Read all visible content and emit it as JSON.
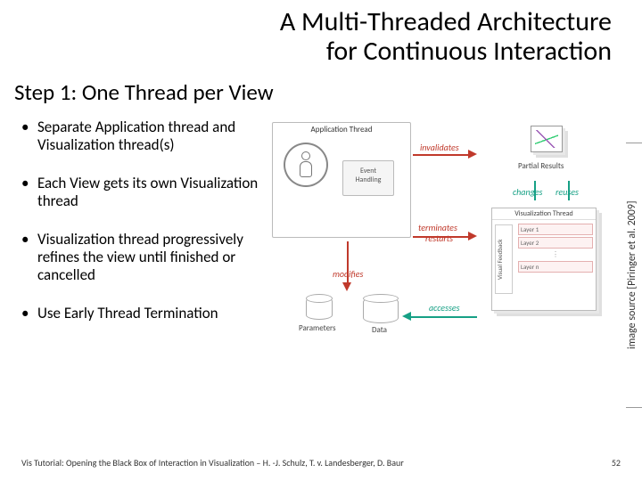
{
  "title_line1": "A Multi-Threaded Architecture",
  "title_line2": "for Continuous Interaction",
  "subtitle": "Step 1: One Thread per View",
  "bullets": [
    "Separate Application thread and Visualization thread(s)",
    "Each View gets its own Visualization thread",
    "Visualization thread progressively refines the view until finished or cancelled",
    "Use Early Thread Termination"
  ],
  "diagram": {
    "app_thread": "Application Thread",
    "event_handling": "Event\nHandling",
    "parameters": "Parameters",
    "data": "Data",
    "partial_results": "Partial Results",
    "vis_thread": "Visualization Thread",
    "visual_feedback": "Visual Feedback",
    "layers": [
      "Layer 1",
      "Layer 2",
      "Layer n"
    ],
    "labels": {
      "invalidates": "invalidates",
      "modifies": "modifies",
      "terminates": "terminates",
      "restarts": "restarts",
      "changes": "changes",
      "reuses": "reuses",
      "accesses": "accesses"
    }
  },
  "credit": "image source [Piringer et al. 2009]",
  "footer_left": "Vis Tutorial: Opening the Black Box of Interaction in Visualization – H. -J. Schulz, T. v. Landesberger, D. Baur",
  "footer_right": "52"
}
